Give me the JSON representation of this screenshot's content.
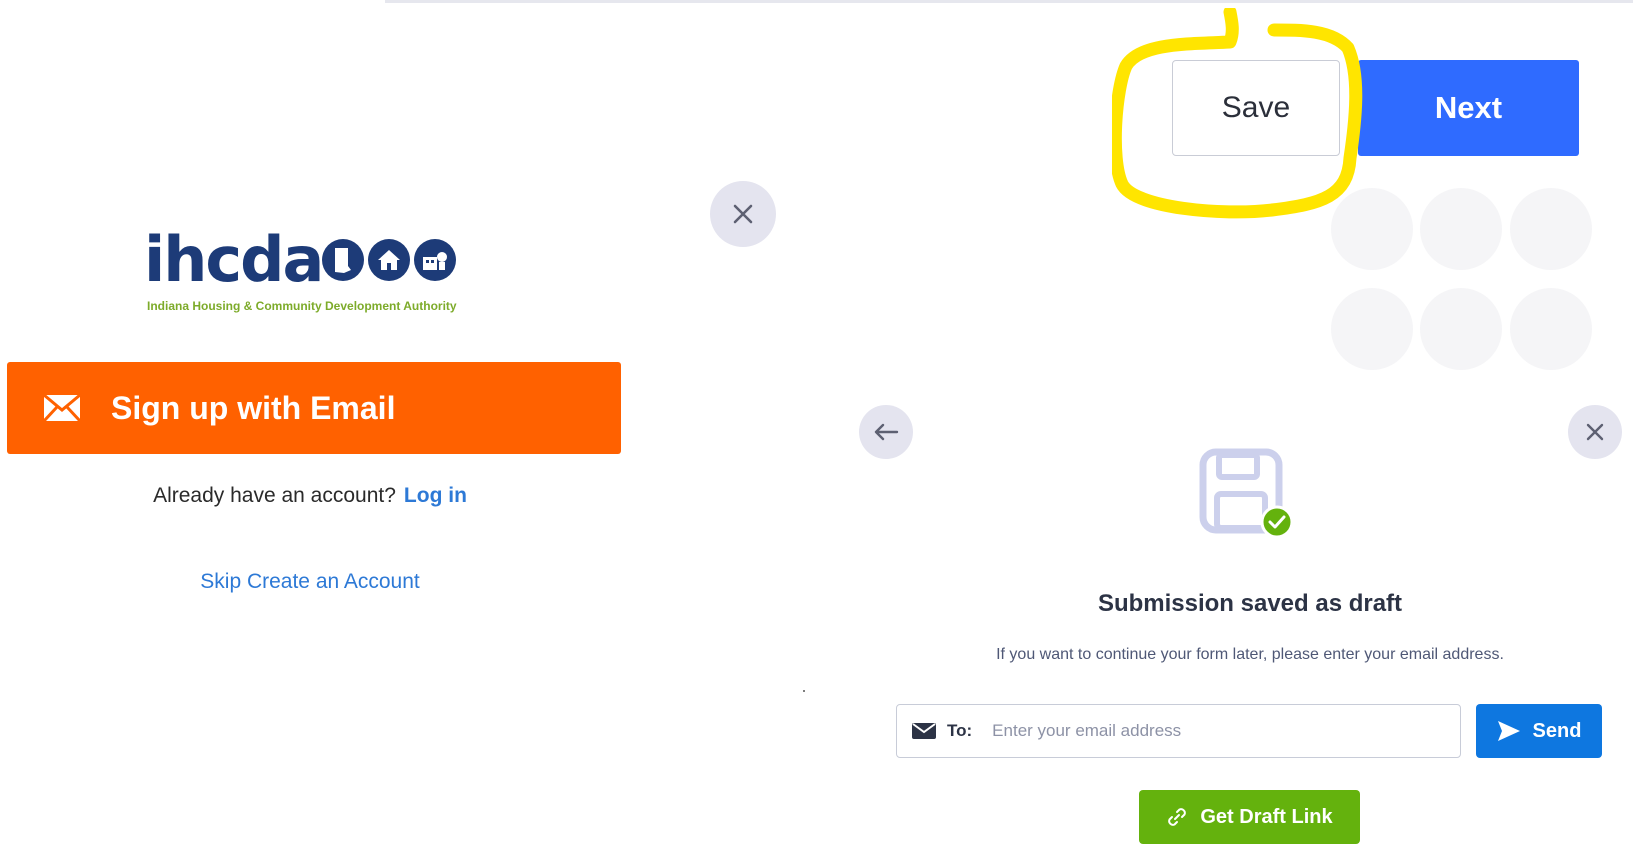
{
  "header": {
    "save_label": "Save",
    "next_label": "Next"
  },
  "signup": {
    "logo_text": "ihcda",
    "logo_subtitle": "Indiana Housing & Community Development Authority",
    "email_button_label": "Sign up with Email",
    "already_text": "Already have an account?",
    "login_label": "Log in",
    "skip_label": "Skip Create an Account"
  },
  "draft_modal": {
    "title": "Submission saved as draft",
    "subtitle": "If you want to continue your form later, please enter your email address.",
    "to_label": "To:",
    "email_placeholder": "Enter your email address",
    "email_value": "",
    "send_label": "Send",
    "draft_link_label": "Get Draft Link"
  },
  "colors": {
    "next_blue": "#2f6bff",
    "email_orange": "#ff6100",
    "send_blue": "#0e77e0",
    "draft_green": "#64b20d",
    "highlight_yellow": "#ffe500",
    "logo_navy": "#1d3b78",
    "logo_green": "#7dab2a"
  }
}
